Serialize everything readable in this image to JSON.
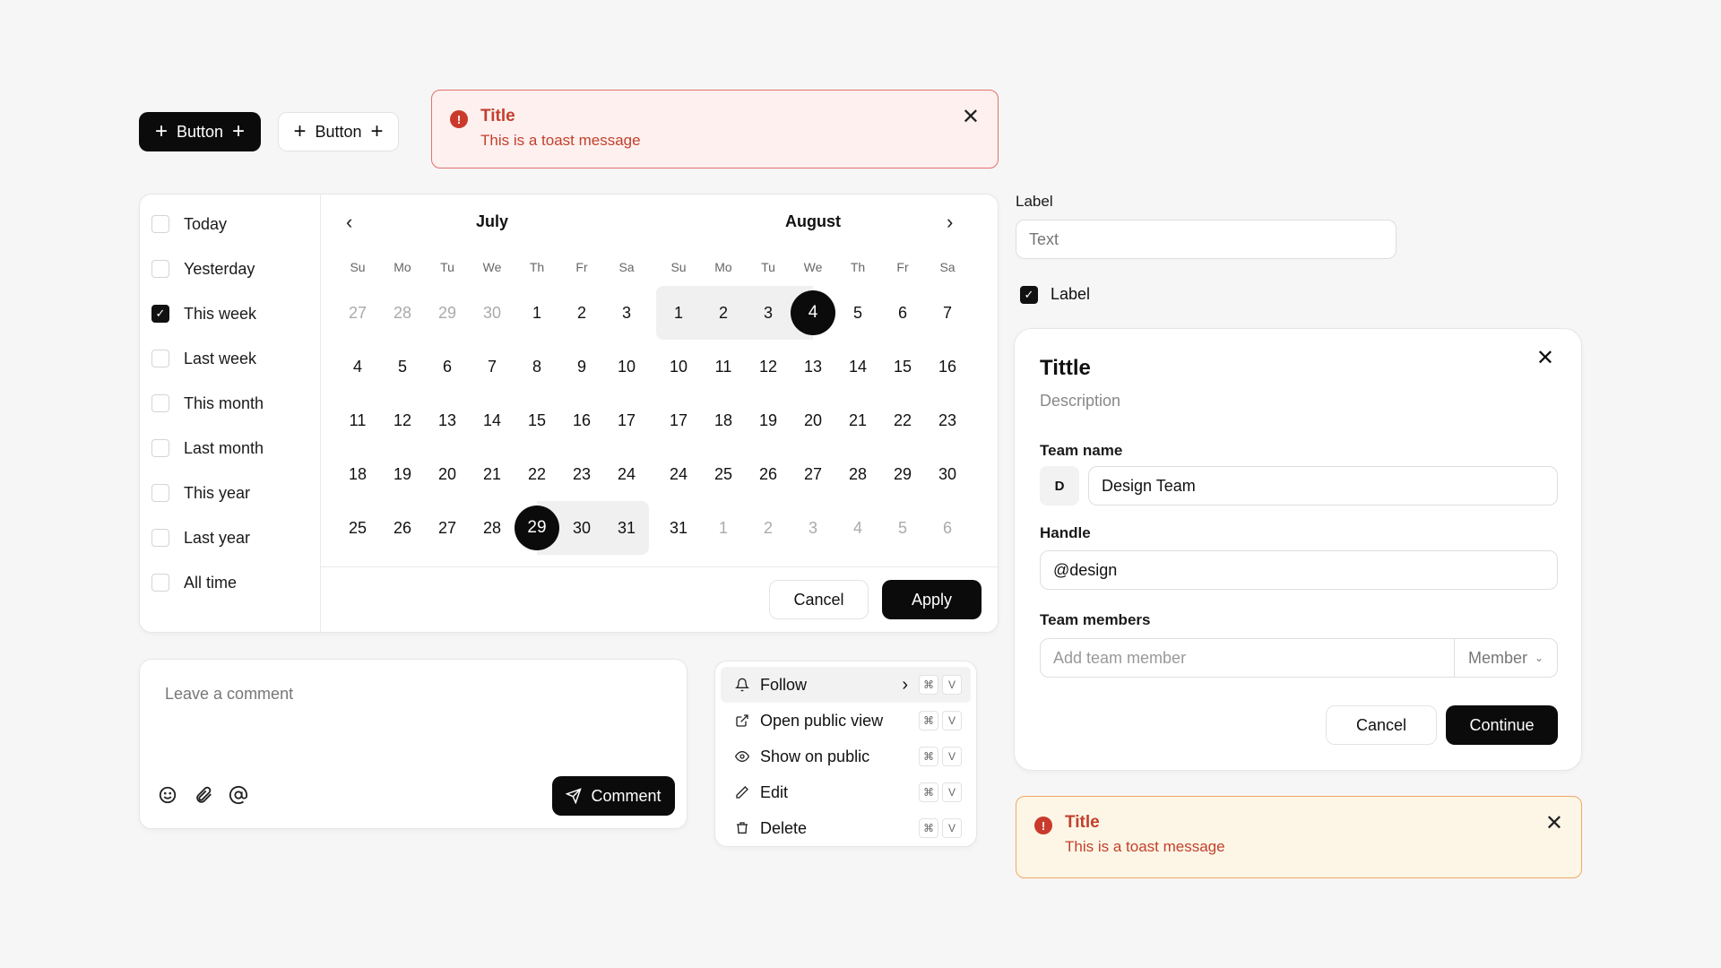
{
  "buttons": {
    "primary_label": "Button",
    "secondary_label": "Button"
  },
  "toast_top": {
    "title": "Title",
    "message": "This is a toast message"
  },
  "toast_bottom": {
    "title": "Title",
    "message": "This is a toast message"
  },
  "date_picker": {
    "presets": [
      {
        "label": "Today",
        "checked": false
      },
      {
        "label": "Yesterday",
        "checked": false
      },
      {
        "label": "This week",
        "checked": true
      },
      {
        "label": "Last week",
        "checked": false
      },
      {
        "label": "This month",
        "checked": false
      },
      {
        "label": "Last month",
        "checked": false
      },
      {
        "label": "This year",
        "checked": false
      },
      {
        "label": "Last year",
        "checked": false
      },
      {
        "label": "All time",
        "checked": false
      }
    ],
    "weekdays": [
      "Su",
      "Mo",
      "Tu",
      "We",
      "Th",
      "Fr",
      "Sa"
    ],
    "months": [
      {
        "name": "July",
        "weeks": [
          [
            "27",
            "28",
            "29",
            "30",
            "1",
            "2",
            "3"
          ],
          [
            "4",
            "5",
            "6",
            "7",
            "8",
            "9",
            "10"
          ],
          [
            "11",
            "12",
            "13",
            "14",
            "15",
            "16",
            "17"
          ],
          [
            "18",
            "19",
            "20",
            "21",
            "22",
            "23",
            "24"
          ],
          [
            "25",
            "26",
            "27",
            "28",
            "29",
            "30",
            "31"
          ]
        ],
        "muted_first_row_count": 4,
        "muted_last_row_from": 7,
        "selected": "29",
        "range_after": [
          "30",
          "31"
        ]
      },
      {
        "name": "August",
        "weeks": [
          [
            "1",
            "2",
            "3",
            "4",
            "5",
            "6",
            "7"
          ],
          [
            "10",
            "11",
            "12",
            "13",
            "14",
            "15",
            "16"
          ],
          [
            "17",
            "18",
            "19",
            "20",
            "21",
            "22",
            "23"
          ],
          [
            "24",
            "25",
            "26",
            "27",
            "28",
            "29",
            "30"
          ],
          [
            "31",
            "1",
            "2",
            "3",
            "4",
            "5",
            "6"
          ]
        ],
        "muted_first_row_count": 0,
        "muted_last_row_from": 1,
        "selected": "4",
        "range_before": [
          "1",
          "2",
          "3"
        ]
      }
    ],
    "cancel_label": "Cancel",
    "apply_label": "Apply"
  },
  "text_field": {
    "label": "Label",
    "placeholder": "Text"
  },
  "checkbox": {
    "label": "Label",
    "checked": true
  },
  "modal": {
    "title": "Tittle",
    "description": "Description",
    "team_name_label": "Team name",
    "team_avatar": "D",
    "team_name_value": "Design Team",
    "handle_label": "Handle",
    "handle_value": "@design",
    "members_label": "Team members",
    "members_placeholder": "Add team member",
    "role_value": "Member",
    "cancel_label": "Cancel",
    "continue_label": "Continue"
  },
  "comment": {
    "placeholder": "Leave a comment",
    "submit_label": "Comment"
  },
  "menu": {
    "items": [
      {
        "label": "Follow",
        "icon": "bell-icon",
        "keys": [
          "⌘",
          "V"
        ],
        "active": true
      },
      {
        "label": "Open public view",
        "icon": "external-link-icon",
        "keys": [
          "⌘",
          "V"
        ]
      },
      {
        "label": "Show on public",
        "icon": "eye-icon",
        "keys": [
          "⌘",
          "V"
        ]
      },
      {
        "label": "Edit",
        "icon": "pencil-icon",
        "keys": [
          "⌘",
          "V"
        ]
      },
      {
        "label": "Delete",
        "icon": "trash-icon",
        "keys": [
          "⌘",
          "V"
        ]
      }
    ]
  },
  "colors": {
    "dark": "#0b0b0b",
    "danger": "#c2412d",
    "toast_red_bg": "#fdf0ef",
    "toast_orange_bg": "#fdf6e6"
  }
}
